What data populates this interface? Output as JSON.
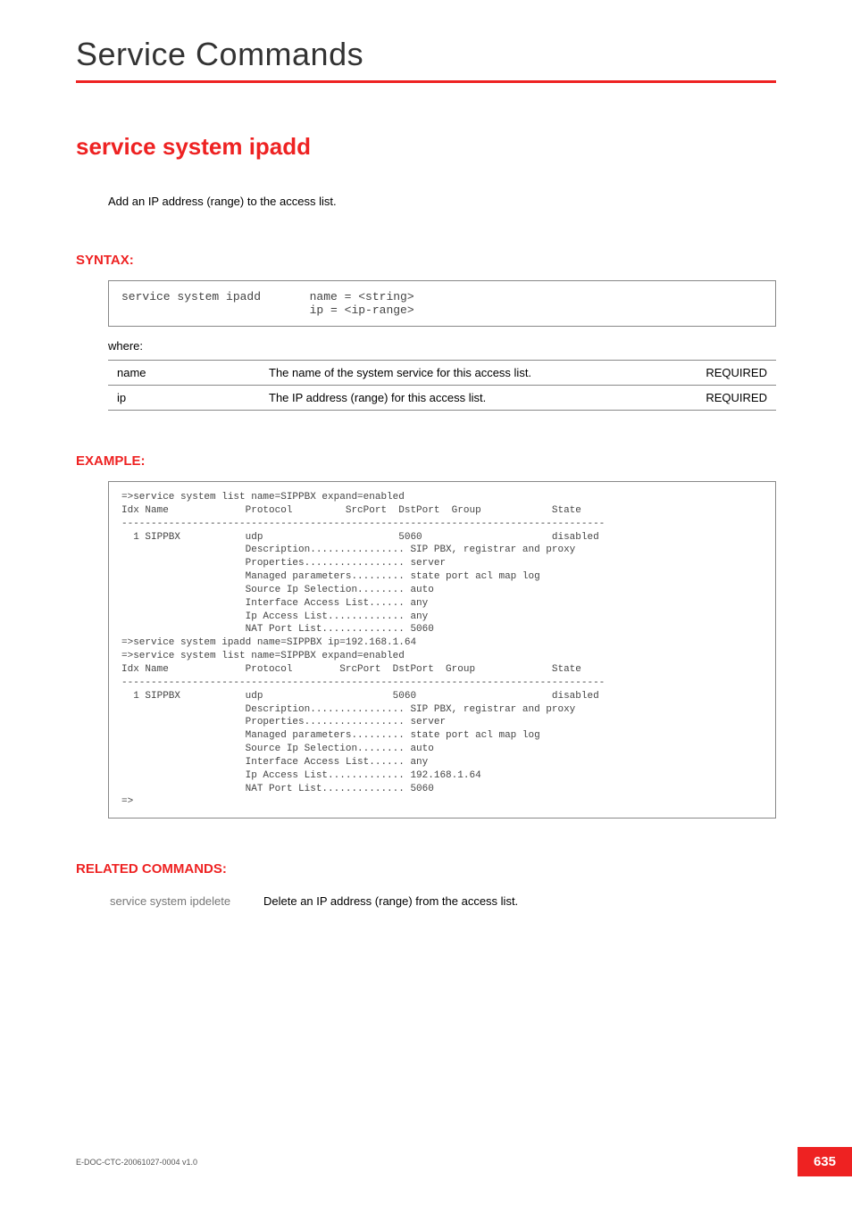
{
  "chapter": "Service Commands",
  "command_title": "service system ipadd",
  "description": "Add an IP address (range) to the access list.",
  "syntax_heading": "SYNTAX:",
  "syntax_block": "service system ipadd       name = <string>\n                           ip = <ip-range>",
  "where_label": "where:",
  "params": [
    {
      "name": "name",
      "desc": "The name of the system service for this access list.",
      "req": "REQUIRED"
    },
    {
      "name": "ip",
      "desc": "The IP address (range) for this access list.",
      "req": "REQUIRED"
    }
  ],
  "example_heading": "EXAMPLE:",
  "example_block": "=>service system list name=SIPPBX expand=enabled\nIdx Name             Protocol         SrcPort  DstPort  Group            State\n----------------------------------------------------------------------------------\n  1 SIPPBX           udp                       5060                      disabled\n                     Description................ SIP PBX, registrar and proxy\n                     Properties................. server\n                     Managed parameters......... state port acl map log\n                     Source Ip Selection........ auto\n                     Interface Access List...... any\n                     Ip Access List............. any\n                     NAT Port List.............. 5060\n=>service system ipadd name=SIPPBX ip=192.168.1.64\n=>service system list name=SIPPBX expand=enabled\nIdx Name             Protocol        SrcPort  DstPort  Group             State\n----------------------------------------------------------------------------------\n  1 SIPPBX           udp                      5060                       disabled\n                     Description................ SIP PBX, registrar and proxy\n                     Properties................. server\n                     Managed parameters......... state port acl map log\n                     Source Ip Selection........ auto\n                     Interface Access List...... any\n                     Ip Access List............. 192.168.1.64\n                     NAT Port List.............. 5060\n=>",
  "related_heading": "RELATED COMMANDS:",
  "related": [
    {
      "cmd": "service system ipdelete",
      "desc": "Delete an IP address (range) from the access list."
    }
  ],
  "footer": {
    "doc_id": "E-DOC-CTC-20061027-0004 v1.0",
    "page": "635"
  }
}
